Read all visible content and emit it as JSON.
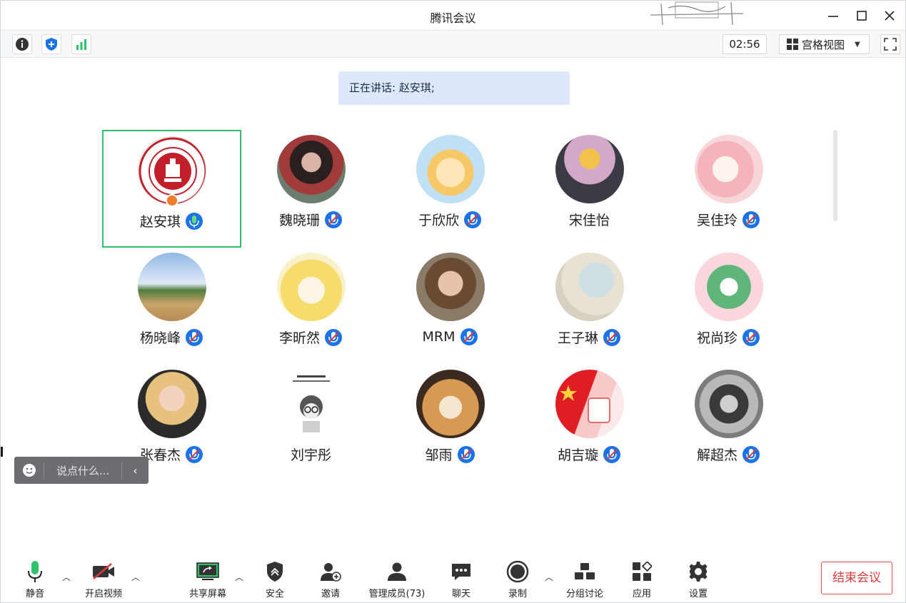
{
  "window": {
    "title": "腾讯会议"
  },
  "toolbar": {
    "timer": "02:56",
    "view_mode": "宫格视图"
  },
  "speaking_banner": "正在讲话: 赵安琪;",
  "participants": [
    {
      "name": "赵安琪",
      "mic": "active",
      "host": true
    },
    {
      "name": "魏晓珊",
      "mic": "muted"
    },
    {
      "name": "于欣欣",
      "mic": "muted"
    },
    {
      "name": "宋佳怡",
      "mic": "none"
    },
    {
      "name": "吴佳玲",
      "mic": "muted"
    },
    {
      "name": "杨晓峰",
      "mic": "muted"
    },
    {
      "name": "李昕然",
      "mic": "muted"
    },
    {
      "name": "MRM",
      "mic": "muted"
    },
    {
      "name": "王子琳",
      "mic": "muted"
    },
    {
      "name": "祝尚珍",
      "mic": "muted"
    },
    {
      "name": "张春杰",
      "mic": "muted"
    },
    {
      "name": "刘宇彤",
      "mic": "none"
    },
    {
      "name": "邹雨",
      "mic": "muted"
    },
    {
      "name": "胡吉璇",
      "mic": "muted"
    },
    {
      "name": "解超杰",
      "mic": "muted"
    }
  ],
  "chat": {
    "placeholder": "说点什么..."
  },
  "bottombar": {
    "mute": "静音",
    "video": "开启视频",
    "share": "共享屏幕",
    "security": "安全",
    "invite": "邀请",
    "members": "管理成员(73)",
    "chat": "聊天",
    "record": "录制",
    "breakout": "分组讨论",
    "apps": "应用",
    "settings": "设置",
    "end": "结束会议"
  },
  "colors": {
    "accent_blue": "#1a73e8",
    "active_green": "#2ec26b",
    "end_red": "#e03b3b",
    "banner_bg": "#dde9fb"
  }
}
